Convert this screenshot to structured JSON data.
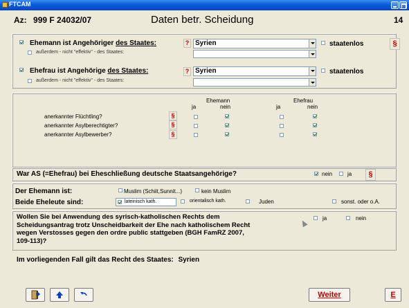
{
  "window": {
    "title": "FTCAM"
  },
  "header": {
    "az_label": "Az:",
    "az_value": "999 F 24032/07",
    "title": "Daten betr. Scheidung",
    "page_number": "14"
  },
  "husband": {
    "label_prefix": "Ehemann ist Angehöriger ",
    "label_link": "des Staates:",
    "nationality": "Syrien",
    "stateless_label": "staatenlos",
    "extra_label": "außerdem - nicht \"effektiv\" - des Staates:",
    "checked": true,
    "extra_checked": false,
    "stateless_checked": false,
    "extra_value": ""
  },
  "wife": {
    "label_prefix": "Ehefrau ist Angehörige ",
    "label_link": "des Staates:",
    "nationality": "Syrien",
    "stateless_label": "staatenlos",
    "extra_label": "außerdem - nicht \"effektiv\" - des Staates:",
    "checked": true,
    "extra_checked": false,
    "stateless_checked": false,
    "extra_value": ""
  },
  "status_table": {
    "col_husband": "Ehemann",
    "col_wife": "Ehefrau",
    "yes": "ja",
    "no": "nein",
    "rows": [
      {
        "label": "anerkannter Flüchtling?",
        "h_yes": false,
        "h_no": true,
        "w_yes": false,
        "w_no": true
      },
      {
        "label": "anerkannter Asylberechtigter?",
        "h_yes": false,
        "h_no": true,
        "w_yes": false,
        "w_no": true
      },
      {
        "label": "anerkannter Asylbewerber?",
        "h_yes": false,
        "h_no": true,
        "w_yes": false,
        "w_no": true
      }
    ]
  },
  "german_question": {
    "text": "War AS (=Ehefrau) bei Eheschließung deutsche Staatsangehörige?",
    "no": "nein",
    "yes": "ja",
    "no_checked": true,
    "yes_checked": false
  },
  "religion": {
    "husband_label": "Der Ehemann ist:",
    "muslim": "Muslim (Schiit,Sunnit...)",
    "not_muslim": "kein Muslim",
    "both_label": "Beide Eheleute sind:",
    "latin": "lateinisch kath.",
    "oriental": "orientalisch kath.",
    "jewish": "Juden",
    "other": "sonst. oder o.A.",
    "latin_checked": true
  },
  "ordre_public": {
    "lines": [
      "Wollen Sie bei Anwendung des syrisch-katholischen Rechts dem",
      "Scheidungsantrag trotz Unscheidbarkeit der Ehe nach katholischem Recht",
      "wegen Verstosses gegen den ordre public stattgeben (BGH FamRZ 2007,",
      "109-113)?"
    ],
    "yes": "ja",
    "no": "nein"
  },
  "applicable_law": {
    "label": "Im vorliegenden Fall gilt das Recht des Staates:",
    "value": "Syrien"
  },
  "footer": {
    "next": "Weiter",
    "end": "E"
  },
  "icons": {
    "help": "?",
    "paragraph": "§"
  },
  "colors": {
    "titlebar": "#0A5AD8",
    "accent_red": "#C00000",
    "window_bg": "#ECE9D8"
  }
}
